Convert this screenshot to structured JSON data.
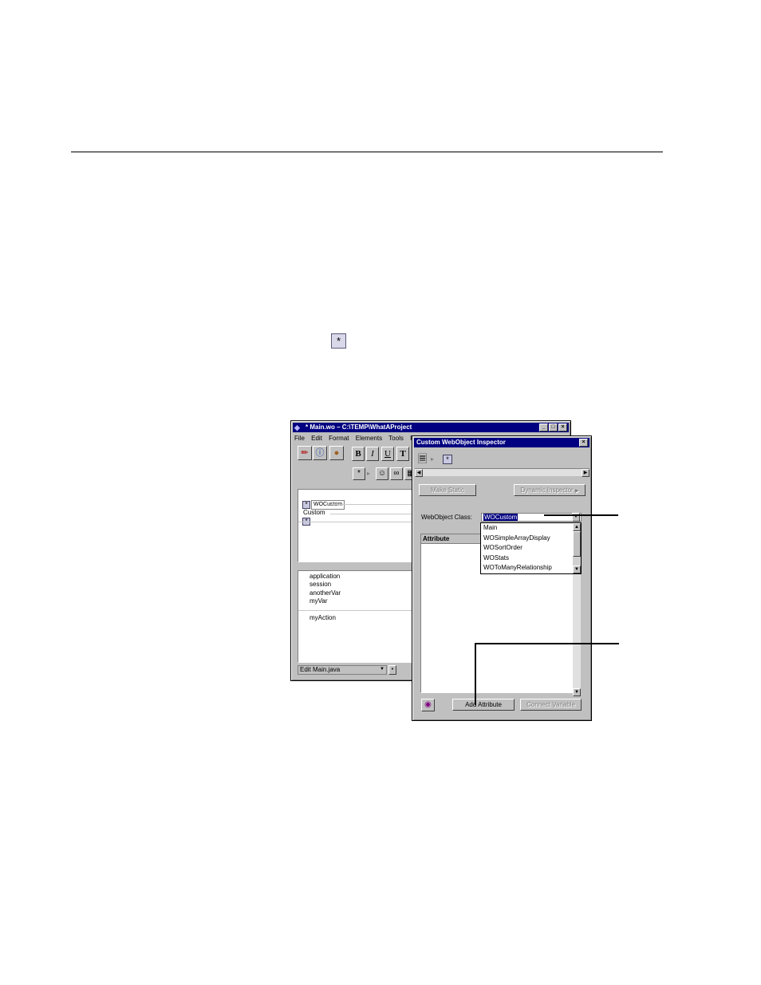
{
  "main_window": {
    "title": "* Main.wo  –  C:\\TEMP\\WhatAProject",
    "menu": [
      "File",
      "Edit",
      "Format",
      "Elements",
      "Tools",
      "P"
    ],
    "format_buttons": [
      "B",
      "I",
      "U",
      "T"
    ],
    "component_name": "WOCustom",
    "component_text": "Custom",
    "variables": [
      "application",
      "session",
      "anotherVar",
      "myVar"
    ],
    "actions": [
      "myAction"
    ],
    "edit_source_select": "Edit Main.java"
  },
  "inspector": {
    "title": "Custom WebObject Inspector",
    "make_static_label": "Make Static",
    "dynamic_inspector_label": "Dynamic Inspector",
    "class_label": "WebObject Class:",
    "class_value": "WOCustom",
    "class_options": [
      "Main",
      "WOSimpleArrayDisplay",
      "WOSortOrder",
      "WOStats",
      "WOToManyRelationship"
    ],
    "attribute_header": "Attribute",
    "add_attribute_label": "Add Attribute",
    "connect_variable_label": "Connect Variable"
  }
}
